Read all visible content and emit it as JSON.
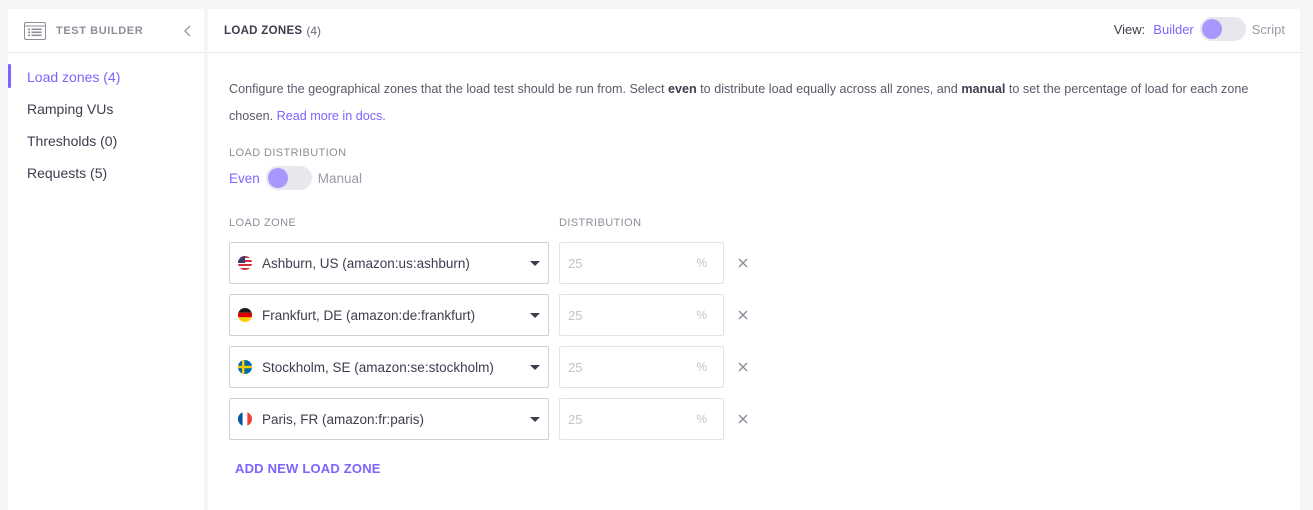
{
  "sidebar": {
    "title": "TEST BUILDER",
    "icon": "list-icon",
    "collapse_icon": "chevron-left-icon",
    "items": [
      {
        "label": "Load zones (4)",
        "active": true
      },
      {
        "label": "Ramping VUs",
        "active": false
      },
      {
        "label": "Thresholds (0)",
        "active": false
      },
      {
        "label": "Requests (5)",
        "active": false
      }
    ]
  },
  "header": {
    "title": "LOAD ZONES",
    "count": "(4)",
    "view_label": "View:",
    "view_builder": "Builder",
    "view_script": "Script"
  },
  "main": {
    "desc_1": "Configure the geographical zones that the load test should be run from. Select ",
    "desc_even": "even",
    "desc_2": " to distribute load equally across all zones, and ",
    "desc_manual": "manual",
    "desc_3": " to set the percentage of load for each zone chosen. ",
    "desc_link": "Read more in docs.",
    "dist_label": "LOAD DISTRIBUTION",
    "dist_even": "Even",
    "dist_manual": "Manual",
    "col_zone": "LOAD ZONE",
    "col_distribution": "DISTRIBUTION",
    "zones": [
      {
        "label": "Ashburn, US (amazon:us:ashburn)",
        "flag": "us-flag-icon",
        "value": "25",
        "unit": "%"
      },
      {
        "label": "Frankfurt, DE (amazon:de:frankfurt)",
        "flag": "de-flag-icon",
        "value": "25",
        "unit": "%"
      },
      {
        "label": "Stockholm, SE (amazon:se:stockholm)",
        "flag": "se-flag-icon",
        "value": "25",
        "unit": "%"
      },
      {
        "label": "Paris, FR (amazon:fr:paris)",
        "flag": "fr-flag-icon",
        "value": "25",
        "unit": "%"
      }
    ],
    "add_zone": "ADD NEW LOAD ZONE"
  },
  "colors": {
    "accent": "#7d64ff",
    "toggle_knob": "#a797ff",
    "toggle_track": "#e7e8ee"
  }
}
